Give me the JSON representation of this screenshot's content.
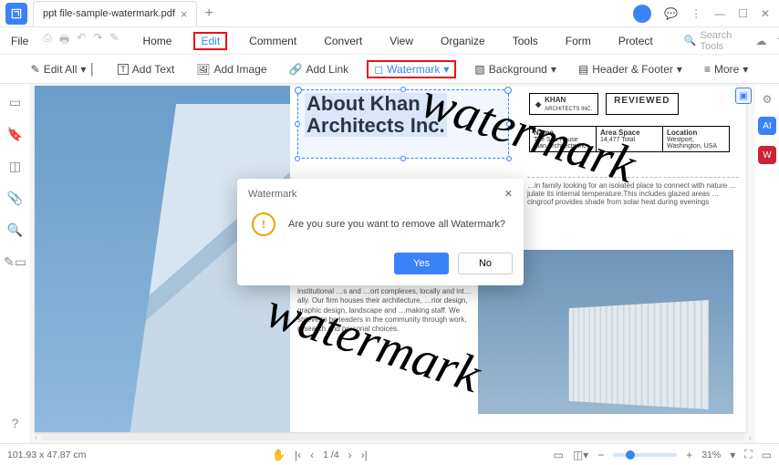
{
  "titlebar": {
    "tab_title": "ppt file-sample-watermark.pdf"
  },
  "menubar": {
    "file": "File",
    "items": [
      "Home",
      "Edit",
      "Comment",
      "Convert",
      "View",
      "Organize",
      "Tools",
      "Form",
      "Protect"
    ],
    "highlight_index": 1,
    "search_placeholder": "Search Tools"
  },
  "toolbar": {
    "edit_all": "Edit All",
    "add_text": "Add Text",
    "add_image": "Add Image",
    "add_link": "Add Link",
    "watermark": "Watermark",
    "background": "Background",
    "header_footer": "Header & Footer",
    "more": "More"
  },
  "document": {
    "title_line1": "About Khan",
    "title_line2": "Architects Inc.",
    "logo_name": "KHAN",
    "logo_sub": "ARCHITECTS INC.",
    "reviewed": "REVIEWED",
    "info": {
      "name_label": "Name",
      "name_val": "The Sea House Kian Architects Inc",
      "area_label": "Area Space",
      "area_val": "14,477 Total",
      "loc_label": "Location",
      "loc_val": "Westport, Washington, USA"
    },
    "para1": "…in family looking for an isolated place to connect with nature\n…julate its internal temperature.This includes glazed areas\n…cingroof provides shade from solar heat during evenings",
    "para2": "firm based in Co…, USA. Our exceptionally talents and experienced staff work on projects from bout… to large institutional …s and …ort complexes, locally and int…ally. Our firm houses their architecture, …rior design, graphic design, landscape and …making staff. We strieve to be leaders in the community through work, research and personal choices.",
    "watermark_text": "watermark"
  },
  "dialog": {
    "title": "Watermark",
    "message": "Are you sure you want to remove all Watermark?",
    "yes": "Yes",
    "no": "No"
  },
  "statusbar": {
    "coords": "101.93 x 47.87 cm",
    "page_current": "1",
    "page_total": "/4",
    "zoom": "31%"
  }
}
